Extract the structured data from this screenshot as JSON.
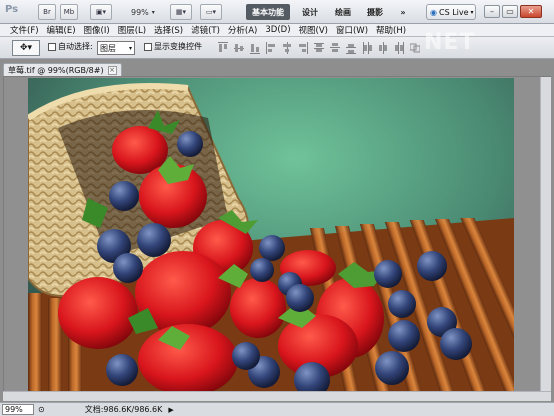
{
  "app": {
    "logo": "Ps",
    "bridge_label": "Br",
    "minibridge_label": "Mb",
    "zoom_value": "99%",
    "workspaces": [
      "基本功能",
      "设计",
      "绘画",
      "摄影"
    ],
    "more_label": "»",
    "cs_live_label": "CS Live"
  },
  "menu": [
    "文件(F)",
    "编辑(E)",
    "图像(I)",
    "图层(L)",
    "选择(S)",
    "滤镜(T)",
    "分析(A)",
    "3D(D)",
    "视图(V)",
    "窗口(W)",
    "帮助(H)"
  ],
  "options": {
    "auto_select_label": "自动选择:",
    "auto_select_value": "图层",
    "show_transform_label": "显示变换控件"
  },
  "document": {
    "tab_title": "草莓.tif @ 99%(RGB/8#)",
    "close_label": "×"
  },
  "status": {
    "zoom": "99%",
    "doc_size": "文档:986.6K/986.6K"
  },
  "colors": {
    "accent_workspace": "#545b63",
    "canvas_bg": "#8e8e8e"
  }
}
